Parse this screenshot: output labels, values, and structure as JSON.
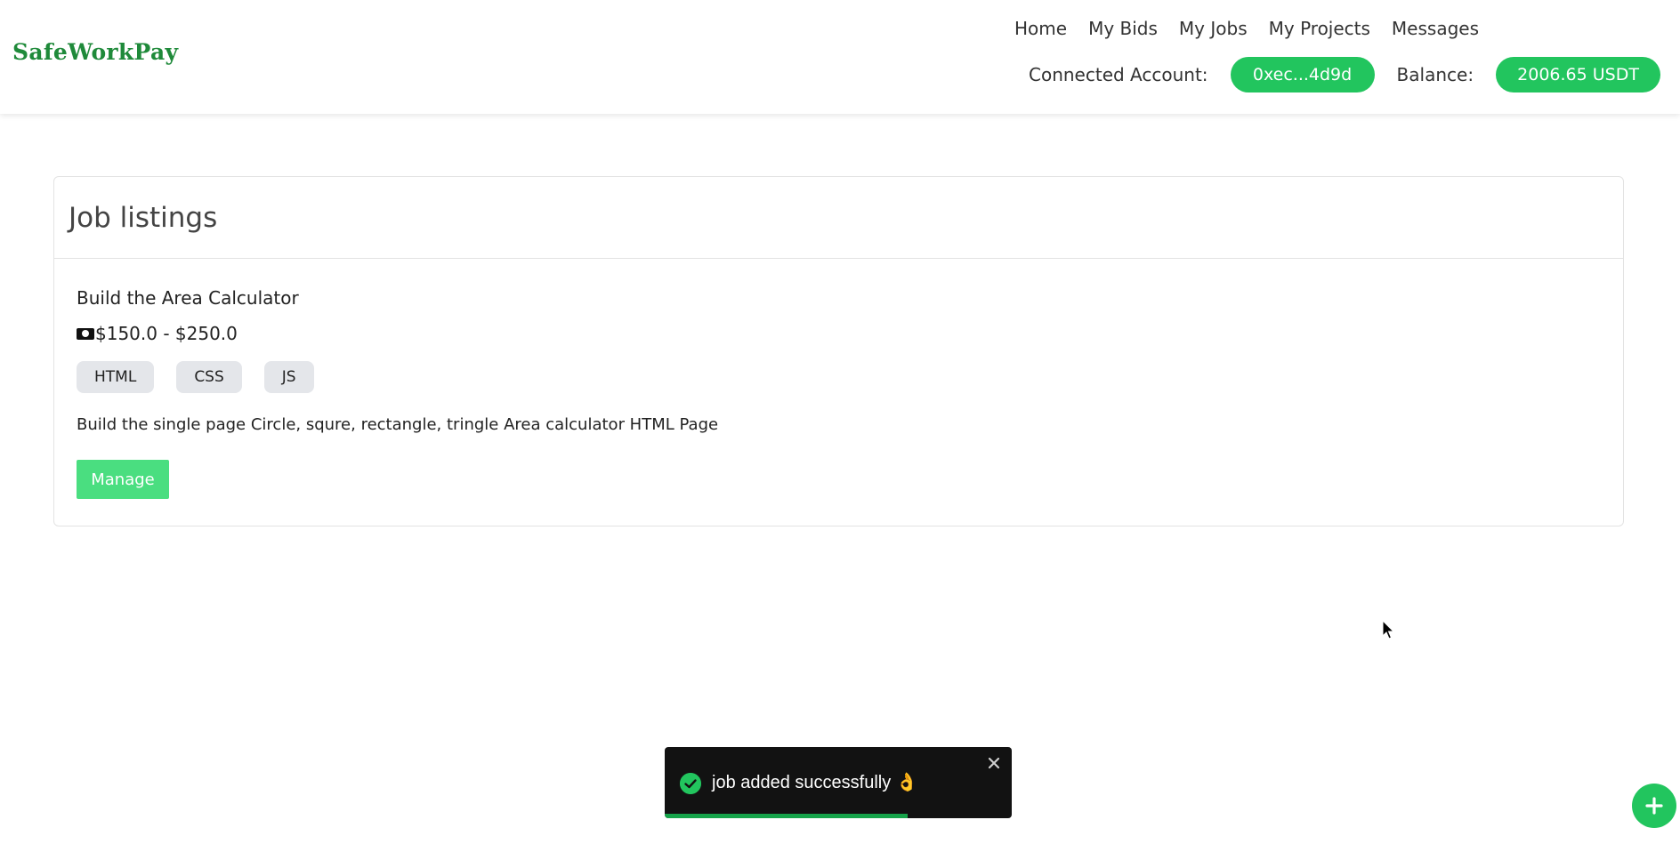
{
  "brand": {
    "name": "SafeWorkPay"
  },
  "nav": {
    "items": [
      {
        "label": "Home"
      },
      {
        "label": "My Bids"
      },
      {
        "label": "My Jobs"
      },
      {
        "label": "My Projects"
      },
      {
        "label": "Messages"
      }
    ]
  },
  "account": {
    "connected_label": "Connected Account:",
    "address": "0xec...4d9d",
    "balance_label": "Balance:",
    "balance": "2006.65 USDT"
  },
  "listings": {
    "title": "Job listings",
    "jobs": [
      {
        "title": "Build the Area Calculator",
        "budget": "$150.0 - $250.0",
        "budget_icon": "money-icon",
        "tags": [
          "HTML",
          "CSS",
          "JS"
        ],
        "description": "Build the single page Circle, squre, rectangle, tringle Area calculator HTML Page",
        "action_label": "Manage"
      }
    ]
  },
  "toast": {
    "message": "job added successfully 👌",
    "progress": 0.7
  },
  "colors": {
    "accent": "#22c55e",
    "brand": "#1f8a3a",
    "button_light": "#4ade80",
    "toast_bg": "#121212",
    "tag_bg": "#e4e6ea"
  }
}
